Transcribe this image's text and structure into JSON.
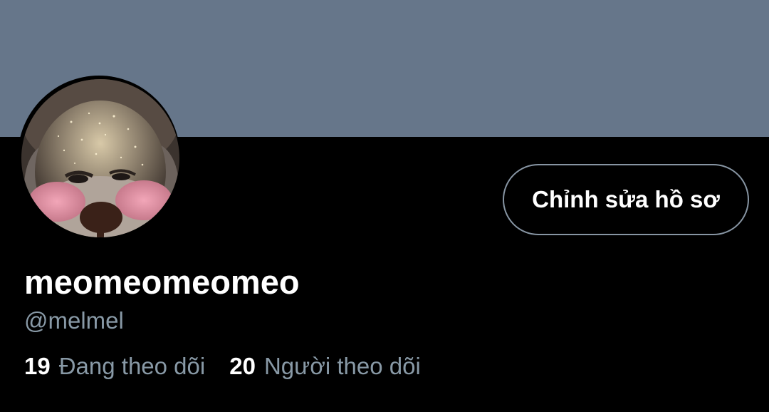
{
  "profile": {
    "display_name": "meomeomeomeo",
    "handle": "@melmel",
    "edit_button_label": "Chỉnh sửa hồ sơ",
    "following_count": "19",
    "following_label": "Đang theo dõi",
    "followers_count": "20",
    "followers_label": "Người theo dõi"
  },
  "colors": {
    "banner": "#66768a",
    "background": "#000000",
    "text_primary": "#ffffff",
    "text_secondary": "#8899a6",
    "button_border": "#8795a3"
  }
}
